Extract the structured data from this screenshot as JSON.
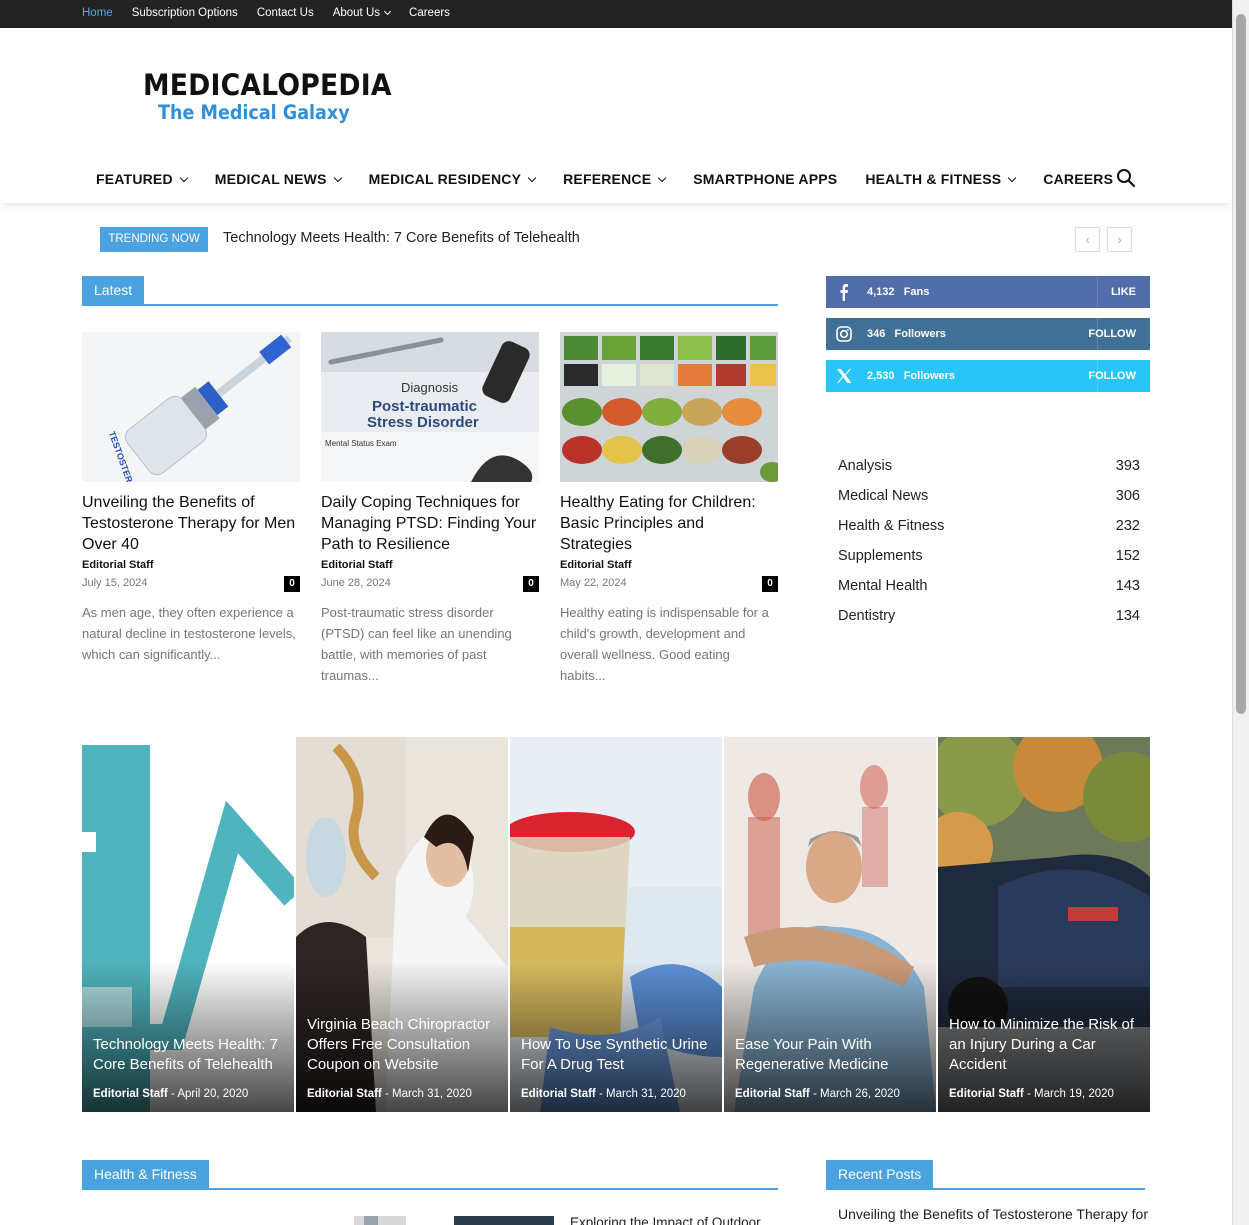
{
  "topbar": {
    "links": [
      "Home",
      "Subscription Options",
      "Contact Us",
      "About Us",
      "Careers"
    ]
  },
  "logo": {
    "line1": "MEDICALOPEDIA",
    "line2": "The Medical Galaxy"
  },
  "nav": {
    "items": [
      "FEATURED",
      "MEDICAL NEWS",
      "MEDICAL RESIDENCY",
      "REFERENCE",
      "SMARTPHONE APPS",
      "HEALTH & FITNESS",
      "CAREERS"
    ]
  },
  "trending": {
    "tag": "TRENDING NOW",
    "text": "Technology Meets Health: 7 Core Benefits of Telehealth",
    "prev": "‹",
    "next": "›"
  },
  "latest": {
    "label": "Latest",
    "cards": [
      {
        "title": "Unveiling the Benefits of Testosterone Therapy for Men Over 40",
        "author": "Editorial Staff",
        "date": "July 15, 2024",
        "comments": "0",
        "excerpt": "As men age, they often experience a natural decline in testosterone levels, which can significantly...",
        "image_text": "TESTOSTERONE"
      },
      {
        "title": "Daily Coping Techniques for Managing PTSD: Finding Your Path to Resilience",
        "author": "Editorial Staff",
        "date": "June 28, 2024",
        "comments": "0",
        "excerpt": "Post-traumatic stress disorder (PTSD) can feel like an unending battle, with memories of past traumas...",
        "image_text": {
          "line1": "Diagnosis",
          "line2": "Post-traumatic",
          "line3": "Stress Disorder",
          "line4": "Mental Status Exam"
        }
      },
      {
        "title": "Healthy Eating for Children: Basic Principles and Strategies",
        "author": "Editorial Staff",
        "date": "May 22, 2024",
        "comments": "0",
        "excerpt": "Healthy eating is indispensable for a child's growth, development and overall wellness. Good eating habits..."
      }
    ]
  },
  "social": [
    {
      "count": "4,132",
      "label": "Fans",
      "action": "LIKE",
      "color": "#516eab",
      "icon": "facebook-icon"
    },
    {
      "count": "346",
      "label": "Followers",
      "action": "FOLLOW",
      "color": "#417096",
      "icon": "instagram-icon"
    },
    {
      "count": "2,530",
      "label": "Followers",
      "action": "FOLLOW",
      "color": "#29c5f6",
      "icon": "x-twitter-icon"
    }
  ],
  "categories": [
    {
      "name": "Analysis",
      "count": "393"
    },
    {
      "name": "Medical News",
      "count": "306"
    },
    {
      "name": "Health & Fitness",
      "count": "232"
    },
    {
      "name": "Supplements",
      "count": "152"
    },
    {
      "name": "Mental Health",
      "count": "143"
    },
    {
      "name": "Dentistry",
      "count": "134"
    }
  ],
  "grid": [
    {
      "title": "Technology Meets Health: 7 Core Benefits of Telehealth",
      "author": "Editorial Staff",
      "date": "April 20, 2020"
    },
    {
      "title": "Virginia Beach Chiropractor Offers Free Consultation Coupon on Website",
      "author": "Editorial Staff",
      "date": "March 31, 2020"
    },
    {
      "title": "How To Use Synthetic Urine For A Drug Test",
      "author": "Editorial Staff",
      "date": "March 31, 2020"
    },
    {
      "title": "Ease Your Pain With Regenerative Medicine",
      "author": "Editorial Staff",
      "date": "March 26, 2020"
    },
    {
      "title": "How to Minimize the Risk of an Injury During a Car Accident",
      "author": "Editorial Staff",
      "date": "March 19, 2020"
    }
  ],
  "sections": {
    "health_fitness": "Health & Fitness",
    "recent_posts": "Recent Posts",
    "recent_first": "Unveiling the Benefits of Testosterone Therapy for",
    "explore": "Exploring the Impact of Outdoor"
  },
  "colors": {
    "accent": "#4aa3df",
    "topbar": "#222222",
    "active_link": "#4db2ec"
  }
}
